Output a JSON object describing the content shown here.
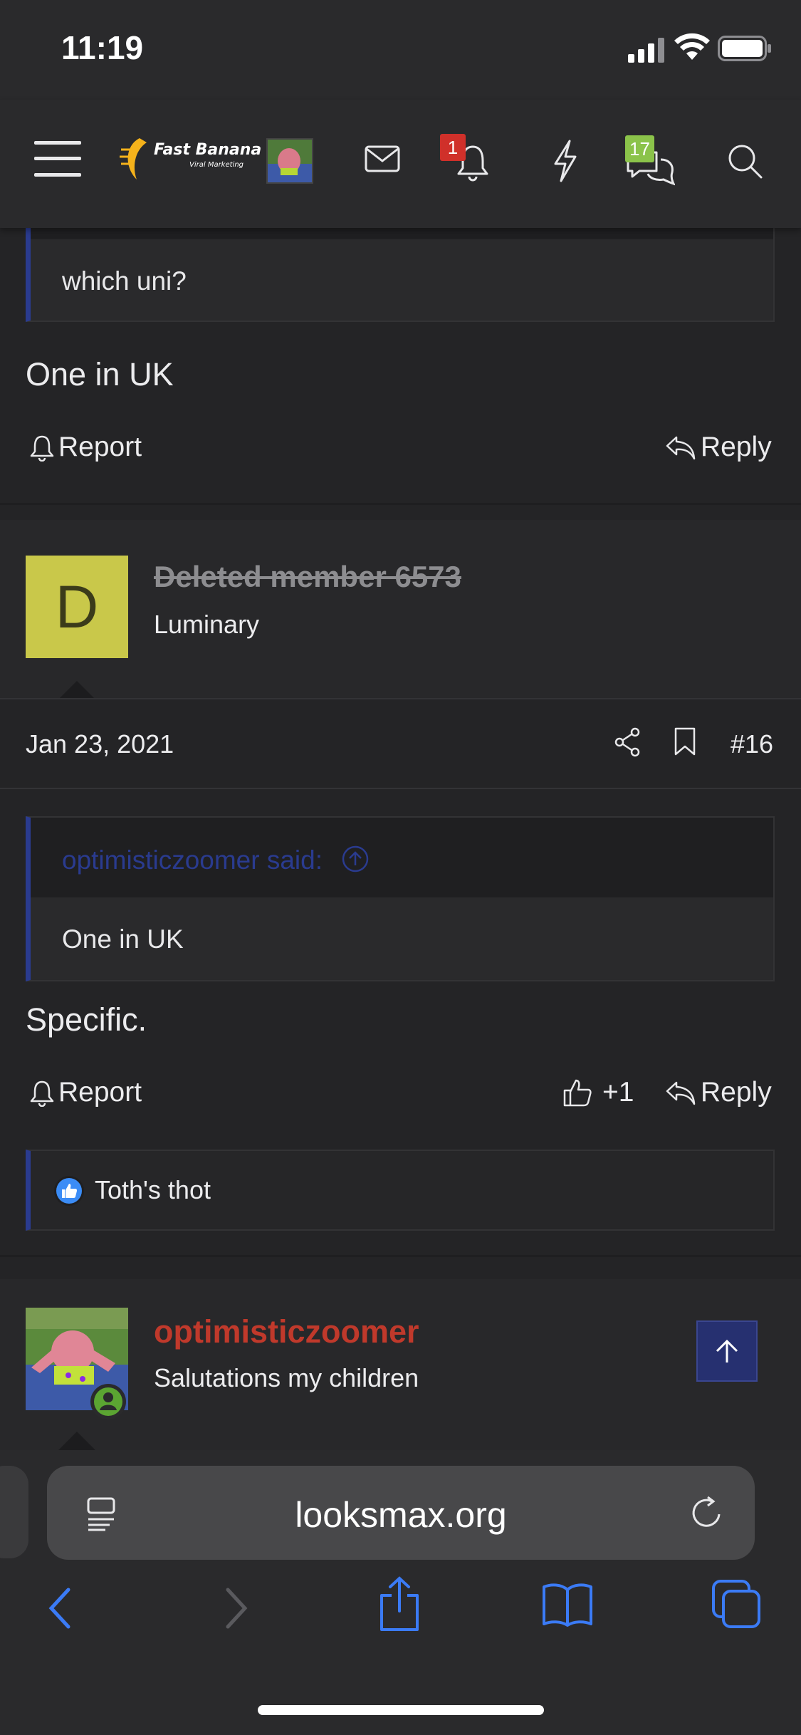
{
  "status_bar": {
    "time": "11:19"
  },
  "header": {
    "logo_text": "Fast Banana",
    "logo_subtext": "Viral Marketing",
    "alerts_badge": "1",
    "conversations_badge": "17"
  },
  "thread": {
    "post15": {
      "quote_text": "which uni?",
      "body": "One in UK",
      "report_label": "Report",
      "reply_label": "Reply"
    },
    "post16": {
      "avatar_letter": "D",
      "username": "Deleted member 6573",
      "user_title": "Luminary",
      "date": "Jan 23, 2021",
      "post_number": "#16",
      "quote_author": "optimisticzoomer said:",
      "quote_text": "One in UK",
      "body": "Specific.",
      "report_label": "Report",
      "like_label": "+1",
      "reply_label": "Reply",
      "reactions": "Toth's thot"
    },
    "post17": {
      "username": "optimisticzoomer",
      "user_title": "Salutations my children"
    }
  },
  "browser": {
    "url": "looksmax.org"
  },
  "colors": {
    "accent_blue": "#2a3b8f",
    "username_red": "#c0392b",
    "safari_blue": "#3b7bf6",
    "alert_red": "#d0302a",
    "convo_green": "#8bc34a"
  },
  "icons": [
    "menu-icon",
    "mail-icon",
    "bell-icon",
    "bolt-icon",
    "conversations-icon",
    "search-icon",
    "share-icon",
    "bookmark-icon",
    "thumbs-up-icon",
    "reply-icon",
    "scroll-up-icon",
    "reader-icon",
    "reload-icon",
    "back-icon",
    "forward-icon",
    "share-sheet-icon",
    "bookmarks-icon",
    "tabs-icon"
  ]
}
